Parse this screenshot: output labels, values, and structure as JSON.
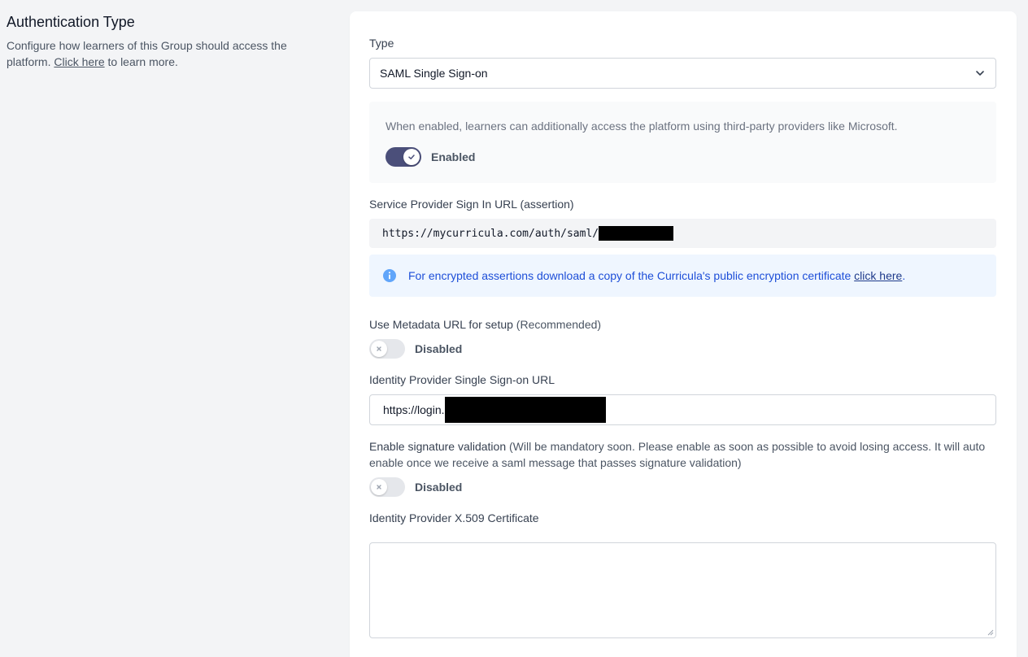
{
  "left": {
    "title": "Authentication Type",
    "desc_before": "Configure how learners of this Group should access the platform.",
    "desc_link": "Click here",
    "desc_after": "to learn more."
  },
  "type_field": {
    "label": "Type",
    "value": "SAML Single Sign-on",
    "icon": "chevron-down-icon"
  },
  "sso_box": {
    "text": "When enabled, learners can additionally access the platform using third-party providers like Microsoft.",
    "toggle_state": true,
    "toggle_label": "Enabled"
  },
  "sp_signin": {
    "label": "Service Provider Sign In URL (assertion)",
    "value": "https://mycurricula.com/auth/saml/"
  },
  "info": {
    "icon": "info-icon",
    "text": "For encrypted assertions download a copy of the Curricula's public encryption certificate",
    "link": "click here",
    "end": "."
  },
  "metadata": {
    "label": "Use Metadata URL for setup",
    "label_muted": "(Recommended)",
    "toggle_state": false,
    "toggle_label": "Disabled"
  },
  "idp_url": {
    "label": "Identity Provider Single Sign-on URL",
    "value": "https://login."
  },
  "signature": {
    "label": "Enable signature validation",
    "label_muted": "(Will be mandatory soon. Please enable as soon as possible to avoid losing access. It will auto enable once we receive a saml message that passes signature validation)",
    "toggle_state": false,
    "toggle_label": "Disabled"
  },
  "certificate": {
    "label": "Identity Provider X.509 Certificate",
    "value": ""
  },
  "colors": {
    "toggle_on": "#4b4f7a",
    "toggle_off": "#e5e7eb",
    "info_bg": "#eff6ff",
    "info_text": "#1d4ed8",
    "page_bg": "#f3f4f6"
  }
}
